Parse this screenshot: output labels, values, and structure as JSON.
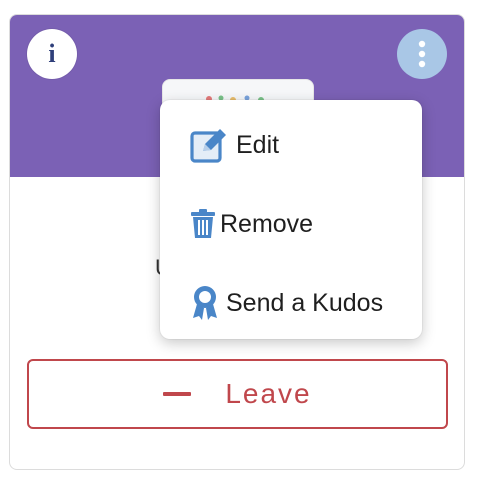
{
  "card": {
    "header_color": "#7b61b5",
    "info_icon": "info-icon",
    "more_icon": "more-vertical-icon",
    "partial_text": "U",
    "leave_label": "Leave"
  },
  "menu": {
    "items": [
      {
        "label": "Edit",
        "icon": "edit-icon",
        "icon_color": "#4a86c8"
      },
      {
        "label": "Remove",
        "icon": "trash-icon",
        "icon_color": "#4a86c8"
      },
      {
        "label": "Send a Kudos",
        "icon": "award-icon",
        "icon_color": "#4a86c8"
      }
    ]
  },
  "colors": {
    "accent_blue": "#4a86c8",
    "danger": "#c0474c",
    "more_button_bg": "#a9c7e6"
  }
}
